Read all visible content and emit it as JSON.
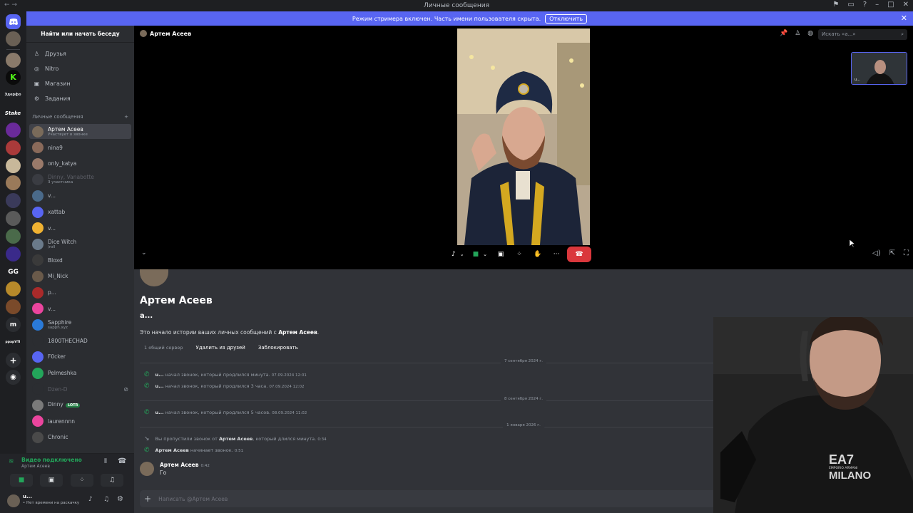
{
  "window": {
    "title": "Личные сообщения"
  },
  "banner": {
    "text": "Режим стримера включен. Часть имени пользователя скрыта.",
    "button": "Отключить"
  },
  "servers": [
    {
      "label": "K",
      "color": "#0b0b0b",
      "text_color": "#53fc18"
    },
    {
      "label": "Эдерфо",
      "color": "#1e1f22",
      "text_color": "#dbdee1"
    },
    {
      "label": "Stake",
      "color": "#1e1f22",
      "text_color": "#ffffff"
    },
    {
      "label": "GG",
      "color": "#1e1f22",
      "text_color": "#ffffff"
    },
    {
      "label": "m",
      "color": "#1e1f22",
      "text_color": "#ffffff"
    },
    {
      "label": "ppapVTI",
      "color": "#1e1f22",
      "text_color": "#dbdee1"
    }
  ],
  "dm_panel": {
    "find_label": "Найти или начать беседу",
    "nav": [
      {
        "label": "Друзья",
        "icon": "friends-icon",
        "glyph": "♙"
      },
      {
        "label": "Nitro",
        "icon": "nitro-icon",
        "glyph": "◎"
      },
      {
        "label": "Магазин",
        "icon": "shop-icon",
        "glyph": "▣"
      },
      {
        "label": "Задания",
        "icon": "quests-icon",
        "glyph": "⚙"
      }
    ],
    "dm_header": "Личные сообщения",
    "dms": [
      {
        "name": "Артем Асеев",
        "sub": "Участвует в звонке",
        "color": "#7a6b5a",
        "active": true
      },
      {
        "name": "nina9",
        "sub": "",
        "color": "#8a6a5a"
      },
      {
        "name": "only_katya",
        "sub": "",
        "color": "#9a7a6a"
      },
      {
        "name": "Dinny, Vanabotte",
        "sub": "3 участника",
        "color": "#3a3c42",
        "faded": true
      },
      {
        "name": "v...",
        "sub": "",
        "color": "#4a6a8a"
      },
      {
        "name": "xattab",
        "sub": "",
        "color": "#5865f2"
      },
      {
        "name": "v...",
        "sub": "",
        "color": "#f0b232"
      },
      {
        "name": "Dice Witch",
        "sub": "/roll",
        "color": "#6a7a8a"
      },
      {
        "name": "Bloxd",
        "sub": "",
        "color": "#3a3a3a"
      },
      {
        "name": "Mi_Nick",
        "sub": "",
        "color": "#6a5a4a"
      },
      {
        "name": "p...",
        "sub": "",
        "color": "#aa2a2a"
      },
      {
        "name": "v...",
        "sub": "",
        "color": "#eb459e"
      },
      {
        "name": "Sapphire",
        "sub": "sapph.xyz",
        "color": "#2a7ad8"
      },
      {
        "name": "1800THECHAD",
        "sub": "",
        "color": "#2b2d31"
      },
      {
        "name": "F0cker",
        "sub": "",
        "color": "#5865f2"
      },
      {
        "name": "Pelmeshka",
        "sub": "",
        "color": "#23a55a"
      },
      {
        "name": "Dzen-D",
        "sub": "",
        "color": "#2b2d31",
        "faded": true
      },
      {
        "name": "Dinny",
        "sub": "",
        "color": "#7a7a7a",
        "tag": "LOTR"
      },
      {
        "name": "laurennnn",
        "sub": "",
        "color": "#eb459e"
      },
      {
        "name": "Chronic",
        "sub": "",
        "color": "#4a4a4a"
      }
    ]
  },
  "voice": {
    "status": "Видео подключено",
    "channel": "Артем Асеев"
  },
  "user": {
    "name": "u...",
    "status": "Нет времени на раскачку"
  },
  "call": {
    "header": "Артем Асеев",
    "search_placeholder": "Искать «а...»",
    "pip_label": "u..."
  },
  "chat": {
    "name": "Артем Асеев",
    "handle": "а...",
    "intro_prefix": "Это начало истории ваших личных сообщений с ",
    "intro_name": "Артем Асеев",
    "intro_suffix": ".",
    "mutual": "1 общий сервер",
    "remove_friend": "Удалить из друзей",
    "block": "Заблокировать",
    "dividers": [
      "7 сентября 2024 г.",
      "8 сентября 2024 г.",
      "1 января 2026 г."
    ],
    "calls": [
      {
        "user": "u...",
        "text": "начал звонок, который продлился минута.",
        "time": "07.09.2024 12:01"
      },
      {
        "user": "u...",
        "text": "начал звонок, который продлился 3 часа.",
        "time": "07.09.2024 12:02"
      },
      {
        "user": "u...",
        "text": "начал звонок, который продлился 5 часов.",
        "time": "08.09.2024 11:02"
      }
    ],
    "missed": {
      "prefix": "Вы пропустили звонок от ",
      "user": "Артем Асеев",
      "suffix": ", который длился минута.",
      "time": "0:34"
    },
    "started": {
      "user": "Артем Асеев",
      "text": "начинает звонок.",
      "time": "0:51"
    },
    "message": {
      "author": "Артем Асеев",
      "time": "0:42",
      "text": "Го"
    },
    "input_placeholder": "Написать @Артем Асеев"
  },
  "webcam": {
    "shirt_text_1": "EA7",
    "shirt_text_2": "EMPORIO ARMANI",
    "shirt_text_3": "MILANO"
  }
}
